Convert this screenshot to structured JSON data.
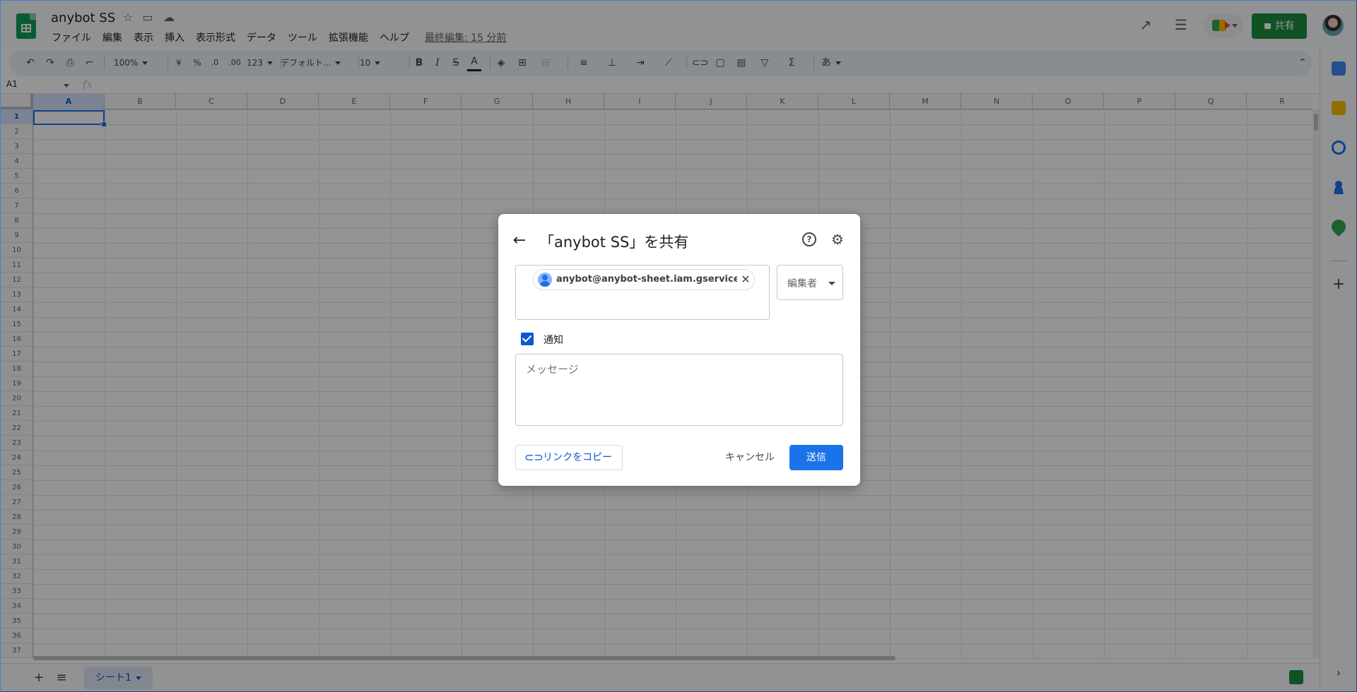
{
  "header": {
    "doc_title": "anybot SS",
    "menus": [
      "ファイル",
      "編集",
      "表示",
      "挿入",
      "表示形式",
      "データ",
      "ツール",
      "拡張機能",
      "ヘルプ"
    ],
    "last_edit": "最終編集: 15 分前",
    "share_label": "共有"
  },
  "toolbar": {
    "zoom": "100%",
    "currency": "¥",
    "percent": "%",
    "dec_decrease": ".0",
    "dec_increase": ".00",
    "format_123": "123",
    "font": "デフォルト...",
    "font_size": "10",
    "bold": "B",
    "italic": "I",
    "strike": "S",
    "text_color": "A",
    "input_tools": "あ"
  },
  "formula_bar": {
    "name_box": "A1",
    "fx": "fx"
  },
  "grid": {
    "columns": [
      "A",
      "B",
      "C",
      "D",
      "E",
      "F",
      "G",
      "H",
      "I",
      "J",
      "K",
      "L",
      "M",
      "N",
      "O",
      "P",
      "Q",
      "R"
    ],
    "rows": [
      "1",
      "2",
      "3",
      "4",
      "5",
      "6",
      "7",
      "8",
      "9",
      "10",
      "11",
      "12",
      "13",
      "14",
      "15",
      "16",
      "17",
      "18",
      "19",
      "20",
      "21",
      "22",
      "23",
      "24",
      "25",
      "26",
      "27",
      "28",
      "29",
      "30",
      "31",
      "32",
      "33",
      "34",
      "35",
      "36",
      "37"
    ],
    "selected_cell": "A1"
  },
  "sheets": {
    "tabs": [
      "シート1"
    ]
  },
  "dialog": {
    "title": "「anybot SS」を共有",
    "recipient": "anybot@anybot-sheet.iam.gserviceac...",
    "role": "編集者",
    "notify_label": "通知",
    "notify_checked": true,
    "message_placeholder": "メッセージ",
    "copy_link_label": "リンクをコピー",
    "cancel_label": "キャンセル",
    "send_label": "送信"
  },
  "colors": {
    "accent": "#1a73e8",
    "share_green": "#1e8e3e",
    "sheets_green": "#0f9d58",
    "overlay": "rgba(0,0,0,0.42)"
  }
}
